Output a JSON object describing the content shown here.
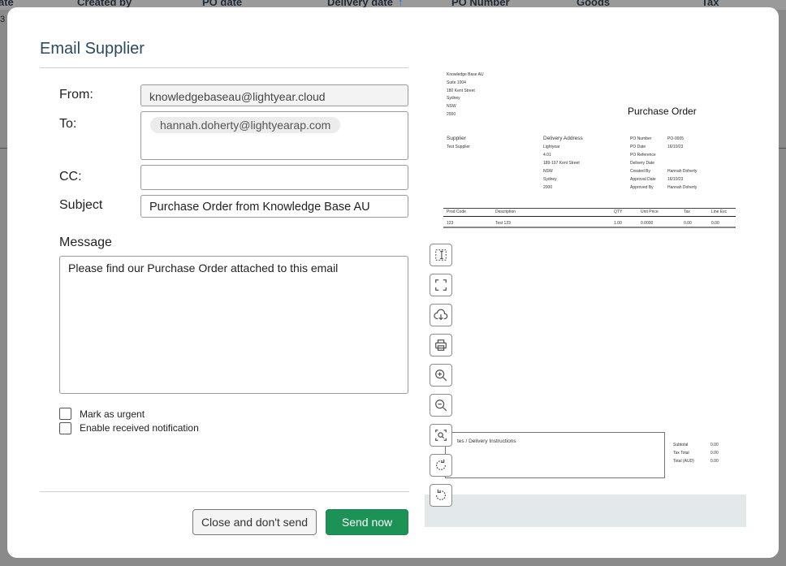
{
  "background": {
    "columns": [
      "ate",
      "Created by",
      "PO date",
      "Delivery date",
      "↑",
      "PO Number",
      "Goods",
      "Tax"
    ],
    "row_fragment": "3"
  },
  "dialog": {
    "title": "Email Supplier",
    "from_label": "From:",
    "from_value": "knowledgebaseau@lightyear.cloud",
    "to_label": "To:",
    "to_recipient": "hannah.doherty@lightyearap.com",
    "cc_label": "CC:",
    "cc_value": "",
    "subject_label": "Subject",
    "subject_value": "Purchase Order from Knowledge Base AU",
    "message_label": "Message",
    "message_value": "Please find our Purchase Order attached to this email",
    "checkboxes": [
      {
        "label": "Mark as urgent",
        "checked": false
      },
      {
        "label": "Enable received notification",
        "checked": false
      }
    ],
    "close_button": "Close and don't send",
    "send_button": "Send now",
    "send_color": "#1c9257"
  },
  "preview": {
    "company_address": [
      "Knowledge Base AU",
      "Suite 1004",
      "180 Kent Street",
      "Sydney",
      "NSW",
      "2000"
    ],
    "title": "Purchase Order",
    "supplier_heading": "Supplier",
    "supplier_name": "Test Supplier",
    "delivery_heading": "Delivery Address",
    "delivery_lines": [
      "Lightyear",
      "4.01",
      "189-197 Kent Street",
      "NSW",
      "Sydney",
      "2000"
    ],
    "meta": [
      {
        "label": "PO Number",
        "value": "PO-0005"
      },
      {
        "label": "PO Date",
        "value": "16/10/23"
      },
      {
        "label": "PO Reference",
        "value": ""
      },
      {
        "label": "Delivery Date",
        "value": ""
      },
      {
        "label": "Created By",
        "value": "Hannah Doherty"
      },
      {
        "label": "Approval Date",
        "value": "16/10/23"
      },
      {
        "label": "Approved By",
        "value": "Hannah Doherty"
      }
    ],
    "table_headers": [
      "Prod Code",
      "Description",
      "QTY",
      "Unit Price",
      "Tax",
      "Line Exc"
    ],
    "table_row": [
      "123",
      "Test 123",
      "1.00",
      "0.0000",
      "0.00",
      "0.00"
    ],
    "notes_label": "tes / Delivery Instructions",
    "totals": [
      {
        "label": "Subtotal",
        "value": "0.00"
      },
      {
        "label": "Tax Total",
        "value": "0.00"
      },
      {
        "label": "Total (AUD)",
        "value": "0.00"
      }
    ],
    "toolbar": [
      "text-select-icon",
      "fullscreen-icon",
      "download-icon",
      "print-icon",
      "zoom-in-icon",
      "zoom-out-icon",
      "fit-page-icon",
      "rotate-clockwise-icon",
      "rotate-counterclockwise-icon"
    ]
  }
}
